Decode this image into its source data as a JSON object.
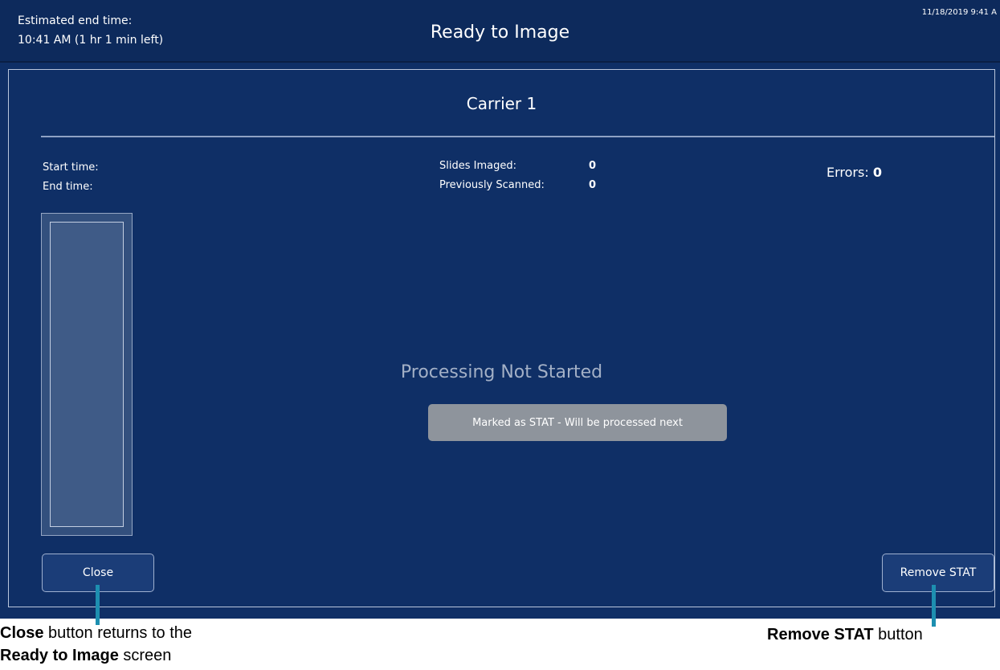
{
  "header": {
    "eta_label": "Estimated end time:",
    "eta_value": "10:41 AM (1 hr 1 min left)",
    "title": "Ready to Image",
    "clock": "11/18/2019 9:41 A"
  },
  "carrier": {
    "title": "Carrier 1",
    "start_time_label": "Start time:",
    "end_time_label": "End time:",
    "slides_imaged_label": "Slides Imaged:",
    "slides_imaged_value": "0",
    "previously_scanned_label": "Previously Scanned:",
    "previously_scanned_value": "0",
    "errors_label": "Errors:",
    "errors_value": "0",
    "status": "Processing Not Started",
    "stat_notice": "Marked as STAT - Will be processed next"
  },
  "buttons": {
    "close": "Close",
    "remove_stat": "Remove STAT"
  },
  "callouts": {
    "close_bold": "Close",
    "close_text1": " button returns to the",
    "close_bold2": "Ready to Image",
    "close_text2": " screen",
    "remove_bold": "Remove STAT",
    "remove_text": " button"
  },
  "colors": {
    "background": "#0f2f66",
    "header": "#0d2a5c",
    "button": "#1b3d78",
    "stat_pill": "#8e949c",
    "callout_pointer": "#1d8fb0"
  }
}
